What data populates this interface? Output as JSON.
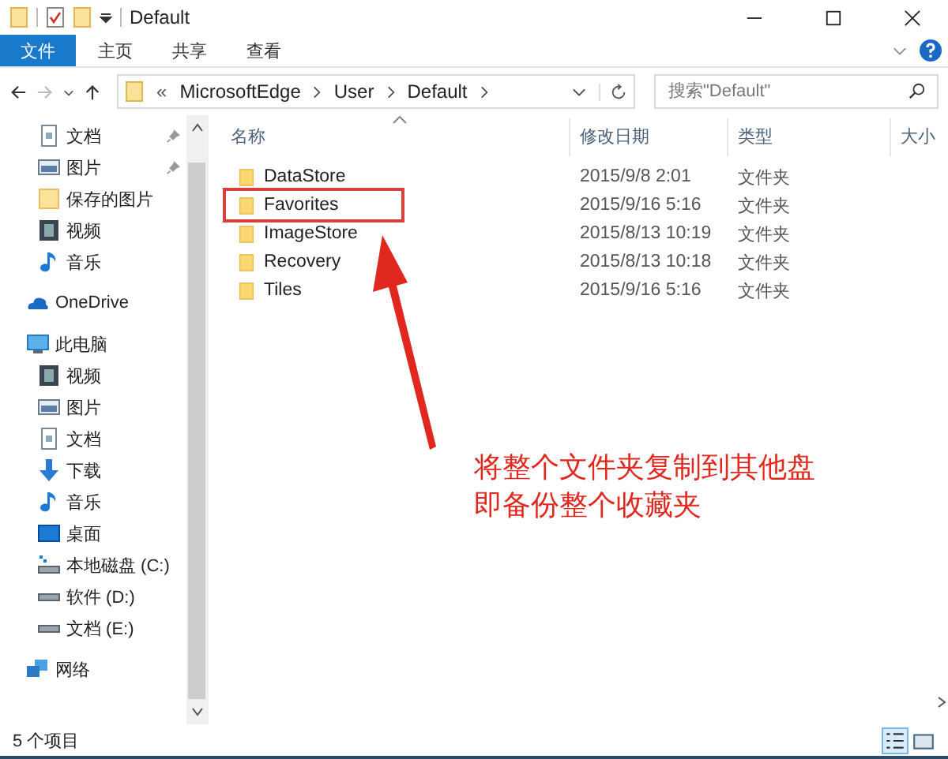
{
  "window": {
    "title": "Default"
  },
  "ribbon_tabs": [
    {
      "label": "文件",
      "selected": true
    },
    {
      "label": "主页",
      "selected": false
    },
    {
      "label": "共享",
      "selected": false
    },
    {
      "label": "查看",
      "selected": false
    }
  ],
  "address": {
    "overflow": "«",
    "segments": [
      "MicrosoftEdge",
      "User",
      "Default"
    ]
  },
  "search": {
    "placeholder": "搜索\"Default\""
  },
  "sidebar": {
    "pinned_items": [
      {
        "label": "文档",
        "kind": "document",
        "pinned": true
      },
      {
        "label": "图片",
        "kind": "picture",
        "pinned": true
      },
      {
        "label": "保存的图片",
        "kind": "folder",
        "pinned": false
      },
      {
        "label": "视频",
        "kind": "video",
        "pinned": false
      },
      {
        "label": "音乐",
        "kind": "music",
        "pinned": false
      }
    ],
    "sections": [
      {
        "label": "OneDrive",
        "kind": "cloud"
      },
      {
        "label": "此电脑",
        "kind": "computer",
        "children": [
          {
            "label": "视频",
            "kind": "video"
          },
          {
            "label": "图片",
            "kind": "picture"
          },
          {
            "label": "文档",
            "kind": "document"
          },
          {
            "label": "下载",
            "kind": "download"
          },
          {
            "label": "音乐",
            "kind": "music"
          },
          {
            "label": "桌面",
            "kind": "desktop"
          },
          {
            "label": "本地磁盘 (C:)",
            "kind": "system-drive"
          },
          {
            "label": "软件 (D:)",
            "kind": "drive"
          },
          {
            "label": "文档 (E:)",
            "kind": "drive"
          }
        ]
      },
      {
        "label": "网络",
        "kind": "network"
      }
    ]
  },
  "table": {
    "columns": [
      "名称",
      "修改日期",
      "类型",
      "大小"
    ],
    "rows": [
      {
        "name": "DataStore",
        "modified": "2015/9/8 2:01",
        "type": "文件夹",
        "highlighted": false
      },
      {
        "name": "Favorites",
        "modified": "2015/9/16 5:16",
        "type": "文件夹",
        "highlighted": true
      },
      {
        "name": "ImageStore",
        "modified": "2015/8/13 10:19",
        "type": "文件夹",
        "highlighted": false
      },
      {
        "name": "Recovery",
        "modified": "2015/8/13 10:18",
        "type": "文件夹",
        "highlighted": false
      },
      {
        "name": "Tiles",
        "modified": "2015/9/16 5:16",
        "type": "文件夹",
        "highlighted": false
      }
    ]
  },
  "annotation": {
    "lines": [
      "将整个文件夹复制到其他盘",
      "即备份整个收藏夹"
    ]
  },
  "status_bar": {
    "item_count": "5 个项目"
  }
}
